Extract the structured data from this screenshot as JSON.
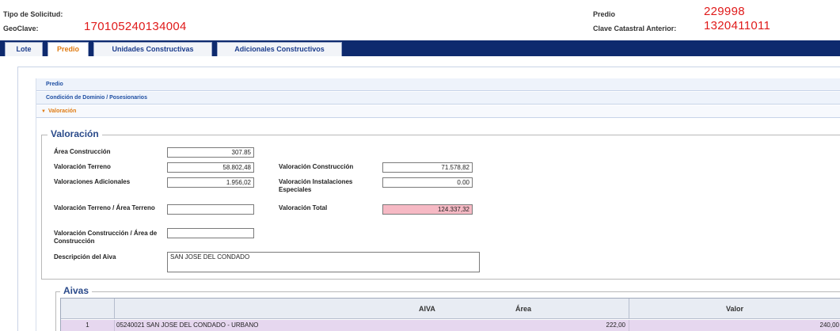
{
  "header": {
    "tipo_solicitud_label": "Tipo de Solicitud:",
    "geoclave_label": "GeoClave:",
    "geoclave_value": "170105240134004",
    "predio_label": "Predio",
    "predio_value": "229998",
    "clave_anterior_label": "Clave Catastral Anterior:",
    "clave_anterior_value": "1320411011"
  },
  "tabs": [
    {
      "label": "Lote"
    },
    {
      "label": "Predio"
    },
    {
      "label": "Unidades Constructivas"
    },
    {
      "label": "Adicionales Constructivos"
    }
  ],
  "accordion": [
    {
      "label": "Predio"
    },
    {
      "label": "Condición de Dominio / Posesionarios"
    },
    {
      "label": "Valoración"
    }
  ],
  "valoracion": {
    "title": "Valoración",
    "area_construccion_label": "Área Construcción",
    "area_construccion_value": "307.85",
    "valoracion_terreno_label": "Valoración Terreno",
    "valoracion_terreno_value": "58.802,48",
    "valoraciones_adicionales_label": "Valoraciones Adicionales",
    "valoraciones_adicionales_value": "1.956,02",
    "val_terreno_area_label": "Valoración Terreno / Área Terreno",
    "val_terreno_area_value": "",
    "val_construccion_area_label": "Valoración Construcción / Área de Construcción",
    "val_construccion_area_value": "",
    "descripcion_aiva_label": "Descripción del Aiva",
    "descripcion_aiva_value": "SAN JOSE DEL CONDADO",
    "valoracion_construccion_label": "Valoración Construcción",
    "valoracion_construccion_value": "71.578,82",
    "valoracion_instalaciones_label": "Valoración Instalaciones Especiales",
    "valoracion_instalaciones_value": "0.00",
    "valoracion_total_label": "Valoración Total",
    "valoracion_total_value": "124.337,32"
  },
  "aivas": {
    "title": "Aivas",
    "columns": [
      "AIVA",
      "Área",
      "Valor"
    ],
    "rows": [
      {
        "num": "1",
        "aiva": "05240021 SAN JOSE DEL CONDADO - URBANO",
        "area": "222,00",
        "valor": "240,00"
      }
    ]
  }
}
